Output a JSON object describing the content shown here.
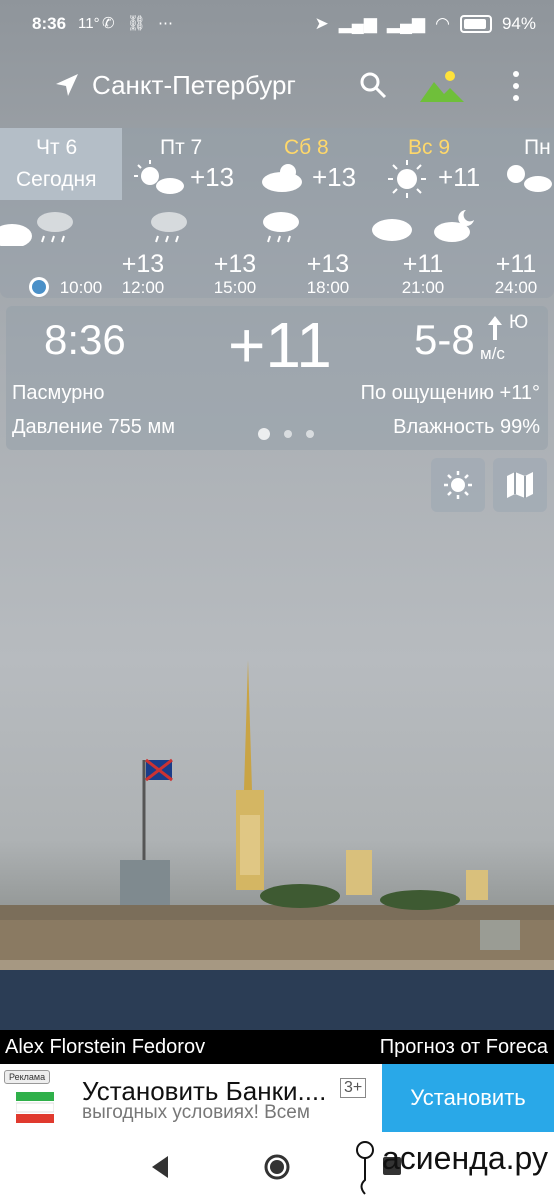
{
  "status_bar": {
    "time": "8:36",
    "temp": "11°",
    "battery": "94%"
  },
  "app_bar": {
    "city": "Санкт-Петербург"
  },
  "days": [
    {
      "name": "Чт 6",
      "sub": "Сегодня",
      "color": "#ffffff"
    },
    {
      "name": "Пт 7",
      "temp": "+13",
      "color": "#ffffff"
    },
    {
      "name": "Сб 8",
      "temp": "+13",
      "color": "#ffd86a"
    },
    {
      "name": "Вс 9",
      "temp": "+11",
      "color": "#ffd86a"
    },
    {
      "name": "Пн",
      "color": "#ffffff"
    }
  ],
  "hours": [
    {
      "time": "10:00"
    },
    {
      "temp": "+13",
      "time": "12:00"
    },
    {
      "temp": "+13",
      "time": "15:00"
    },
    {
      "temp": "+13",
      "time": "18:00"
    },
    {
      "temp": "+11",
      "time": "21:00"
    },
    {
      "temp": "+11",
      "time": "24:00"
    }
  ],
  "current": {
    "time": "8:36",
    "temp": "+11",
    "wind": "5-8",
    "wind_dir": "Ю",
    "wind_unit": "м/с",
    "condition": "Пасмурно",
    "feels_like": "По ощущению +11°",
    "pressure": "Давление 755 мм",
    "humidity": "Влажность 99%"
  },
  "credit": {
    "author": "Alex Florstein Fedorov",
    "source": "Прогноз от Foreca"
  },
  "ad": {
    "label": "Реклама",
    "title": "Установить Банки....",
    "age": "3+",
    "subtitle": "выгодных условиях! Всем",
    "install": "Установить"
  },
  "watermark": "асиенда.ру"
}
